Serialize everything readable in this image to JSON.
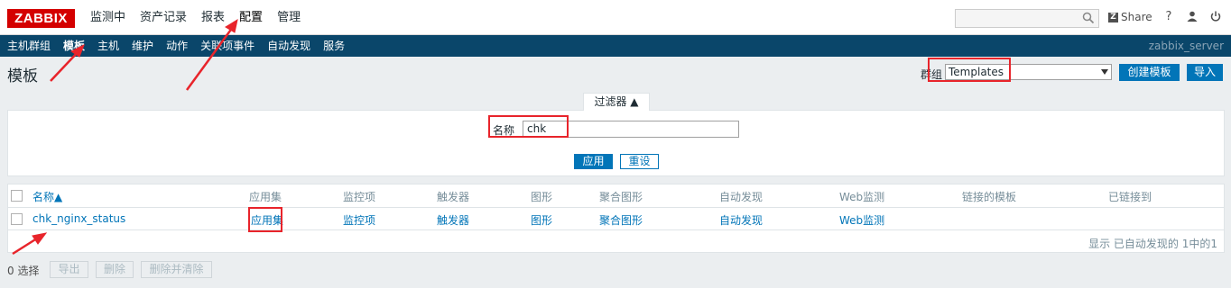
{
  "header": {
    "logo": "ZABBIX",
    "nav": [
      "监测中",
      "资产记录",
      "报表",
      "配置",
      "管理"
    ],
    "share": "Share",
    "help": "?",
    "user": "👤",
    "power": "⏻"
  },
  "subnav": {
    "items": [
      "主机群组",
      "模板",
      "主机",
      "维护",
      "动作",
      "关联项事件",
      "自动发现",
      "服务"
    ],
    "server": "zabbix_server"
  },
  "page": {
    "title": "模板",
    "group_label": "群组",
    "group_value": "Templates",
    "create_button": "创建模板",
    "import_button": "导入"
  },
  "filter": {
    "tab_label": "过滤器 ▲",
    "name_label": "名称",
    "name_value": "chk",
    "apply_button": "应用",
    "reset_button": "重设"
  },
  "table": {
    "headers": [
      "名称▲",
      "应用集",
      "监控项",
      "触发器",
      "图形",
      "聚合图形",
      "自动发现",
      "Web监测",
      "链接的模板",
      "已链接到"
    ],
    "rows": [
      [
        "chk_nginx_status",
        "应用集",
        "监控项",
        "触发器",
        "图形",
        "聚合图形",
        "自动发现",
        "Web监测",
        "",
        ""
      ]
    ],
    "footer": "显示 已自动发现的 1中的1"
  },
  "actions": {
    "selected": "0 选择",
    "export": "导出",
    "delete": "删除",
    "delete_clear": "删除并清除"
  },
  "colors": {
    "brand_red": "#d40000",
    "subnav_bg": "#0a466a",
    "link_blue": "#0275b8",
    "annotation_red": "#e8242b"
  }
}
